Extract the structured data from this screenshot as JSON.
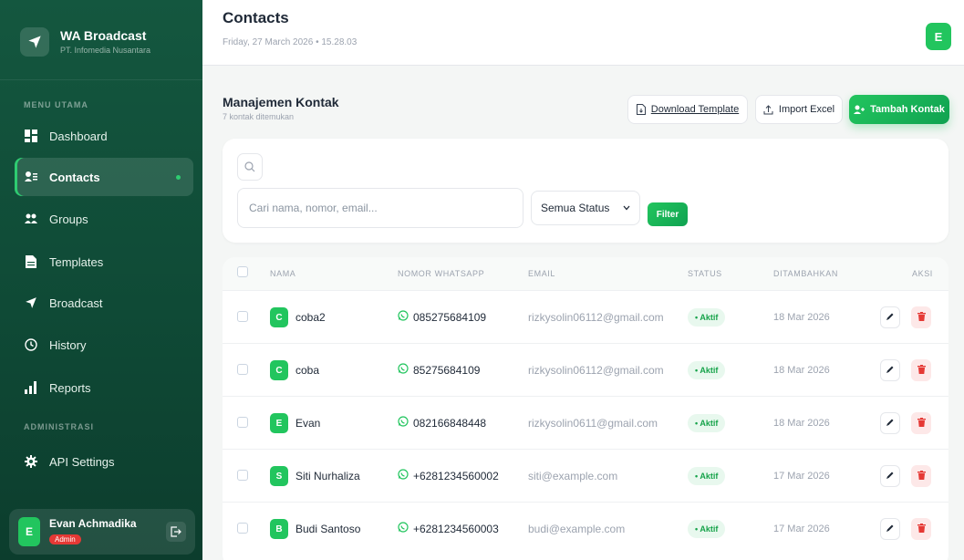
{
  "brand": {
    "title": "WA Broadcast",
    "subtitle": "PT. Infomedia Nusantara"
  },
  "sidebar": {
    "section_main": "MENU UTAMA",
    "section_admin": "ADMINISTRASI",
    "items": [
      {
        "label": "Dashboard",
        "icon": "dashboard-icon"
      },
      {
        "label": "Contacts",
        "icon": "contacts-icon",
        "active": true
      },
      {
        "label": "Groups",
        "icon": "groups-icon"
      },
      {
        "label": "Templates",
        "icon": "templates-icon"
      },
      {
        "label": "Broadcast",
        "icon": "send-icon"
      },
      {
        "label": "History",
        "icon": "clock-icon"
      },
      {
        "label": "Reports",
        "icon": "bar-chart-icon"
      }
    ],
    "admin_items": [
      {
        "label": "API Settings",
        "icon": "gear-icon"
      }
    ]
  },
  "user": {
    "initial": "E",
    "name": "Evan Achmadika",
    "role": "Admin"
  },
  "header": {
    "title": "Contacts",
    "date": "Friday, 27 March 2026 • 15.28.03",
    "avatar_initial": "E"
  },
  "main": {
    "title": "Manajemen Kontak",
    "subtitle": "7 kontak ditemukan",
    "download_label": "Download Template",
    "import_label": "Import Excel",
    "add_label": "Tambah Kontak"
  },
  "filter": {
    "search_placeholder": "Cari nama, nomor, email...",
    "status_selected": "Semua Status",
    "filter_label": "Filter"
  },
  "table": {
    "columns": [
      "NAMA",
      "NOMOR WHATSAPP",
      "EMAIL",
      "STATUS",
      "DITAMBAHKAN",
      "AKSI"
    ],
    "rows": [
      {
        "initial": "C",
        "name": "coba2",
        "phone": "085275684109",
        "email": "rizkysolin06112@gmail.com",
        "status": "• Aktif",
        "date": "18 Mar 2026"
      },
      {
        "initial": "C",
        "name": "coba",
        "phone": "85275684109",
        "email": "rizkysolin06112@gmail.com",
        "status": "• Aktif",
        "date": "18 Mar 2026"
      },
      {
        "initial": "E",
        "name": "Evan",
        "phone": "082166848448",
        "email": "rizkysolin0611@gmail.com",
        "status": "• Aktif",
        "date": "18 Mar 2026"
      },
      {
        "initial": "S",
        "name": "Siti Nurhaliza",
        "phone": "+6281234560002",
        "email": "siti@example.com",
        "status": "• Aktif",
        "date": "17 Mar 2026"
      },
      {
        "initial": "B",
        "name": "Budi Santoso",
        "phone": "+6281234560003",
        "email": "budi@example.com",
        "status": "• Aktif",
        "date": "17 Mar 2026"
      }
    ]
  },
  "colors": {
    "sidebar": "#14573f",
    "accent": "#22c55e",
    "danger": "#e53935"
  }
}
